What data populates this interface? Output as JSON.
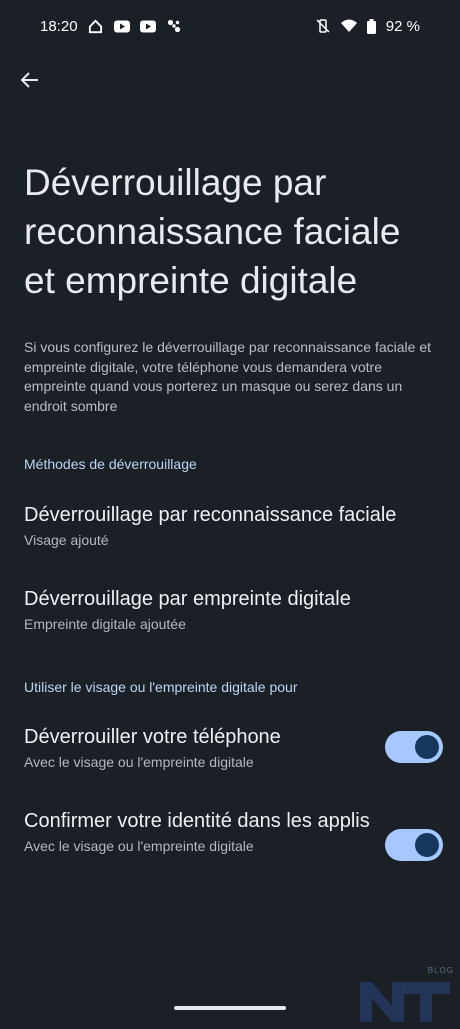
{
  "status_bar": {
    "time": "18:20",
    "battery": "92 %",
    "left_icons": [
      "home-icon",
      "youtube-icon",
      "youtube-icon",
      "fan-icon"
    ],
    "right_icons": [
      "vibrate-off-icon",
      "wifi-icon",
      "battery-icon"
    ]
  },
  "header": {
    "back_icon": "arrow-left-icon",
    "title": "Déverrouillage par reconnaissance faciale et empreinte digitale"
  },
  "description": "Si vous configurez le déverrouillage par reconnaissance faciale et empreinte digitale, votre téléphone vous demandera votre empreinte quand vous porterez un masque ou serez dans un endroit sombre",
  "sections": [
    {
      "header": "Méthodes de déverrouillage",
      "items": [
        {
          "title": "Déverrouillage par reconnaissance faciale",
          "subtitle": "Visage ajouté"
        },
        {
          "title": "Déverrouillage par empreinte digitale",
          "subtitle": "Empreinte digitale ajoutée"
        }
      ]
    },
    {
      "header": "Utiliser le visage ou l'empreinte digitale pour",
      "items": [
        {
          "title": "Déverrouiller votre téléphone",
          "subtitle": "Avec le visage ou l'empreinte digitale",
          "toggle_on": true
        },
        {
          "title": "Confirmer votre identité dans les applis",
          "subtitle": "Avec le visage ou l'empreinte digitale",
          "toggle_on": true
        }
      ]
    }
  ],
  "watermark": {
    "text": "BLOG"
  },
  "colors": {
    "background": "#1b1f26",
    "accent": "#a6c8ff",
    "section_header": "#bcd6f5"
  }
}
